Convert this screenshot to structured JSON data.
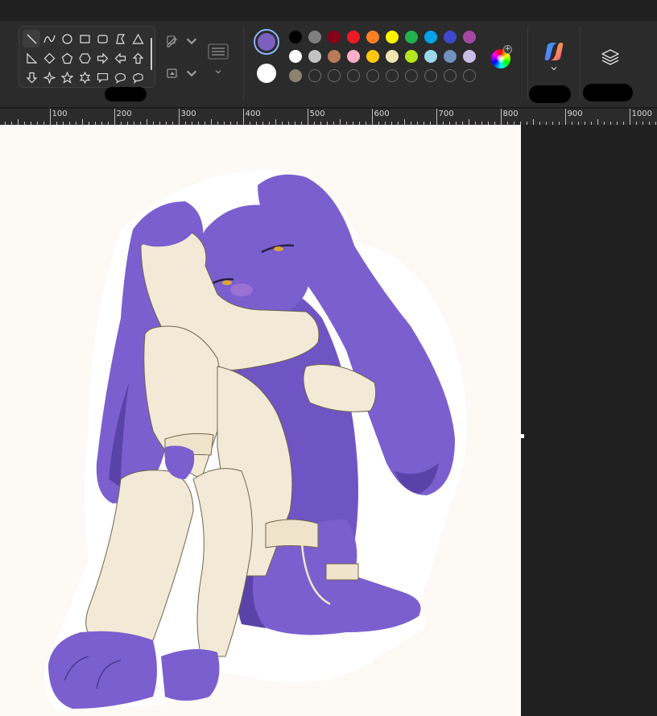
{
  "ruler": {
    "labels": [
      "100",
      "200",
      "300",
      "400",
      "500",
      "600",
      "700",
      "800",
      "900",
      "1000"
    ]
  },
  "shapes": {
    "items": [
      {
        "name": "line-shape-icon",
        "active": true
      },
      {
        "name": "curve-shape-icon"
      },
      {
        "name": "oval-shape-icon"
      },
      {
        "name": "rectangle-shape-icon"
      },
      {
        "name": "rounded-rectangle-shape-icon"
      },
      {
        "name": "polygon-shape-icon"
      },
      {
        "name": "triangle-shape-icon"
      },
      {
        "name": "right-triangle-shape-icon"
      },
      {
        "name": "diamond-shape-icon"
      },
      {
        "name": "pentagon-shape-icon"
      },
      {
        "name": "hexagon-shape-icon"
      },
      {
        "name": "right-arrow-shape-icon"
      },
      {
        "name": "left-arrow-shape-icon"
      },
      {
        "name": "up-arrow-shape-icon"
      },
      {
        "name": "down-arrow-shape-icon"
      },
      {
        "name": "four-point-star-shape-icon"
      },
      {
        "name": "five-point-star-shape-icon"
      },
      {
        "name": "six-point-star-shape-icon"
      },
      {
        "name": "rect-callout-shape-icon"
      },
      {
        "name": "oval-callout-shape-icon"
      },
      {
        "name": "cloud-callout-shape-icon"
      },
      {
        "name": "heart-shape-icon"
      },
      {
        "name": "lightning-shape-icon"
      }
    ]
  },
  "colors": {
    "color1": "#7b5fbf",
    "color2": "#ffffff",
    "palette_row1": [
      "#000000",
      "#7f7f7f",
      "#880015",
      "#ed1c24",
      "#ff7f27",
      "#fff200",
      "#22b14c",
      "#00a2e8",
      "#3f48cc",
      "#a349a4"
    ],
    "palette_row2": [
      "#ffffff",
      "#c3c3c3",
      "#b97a57",
      "#ffaec9",
      "#ffc90e",
      "#efe4b0",
      "#b5e61d",
      "#99d9ea",
      "#7092be",
      "#c8bfe7"
    ],
    "palette_row3_first": "#8c8270",
    "empty_slots": 9
  },
  "theme": {
    "ribbon_bg": "#2b2b2b",
    "canvas_bg": "#fdfaf6",
    "character_purple": "#7b5fcf",
    "character_shadow": "#5a43a8",
    "sweater_cream": "#f2ead6"
  }
}
